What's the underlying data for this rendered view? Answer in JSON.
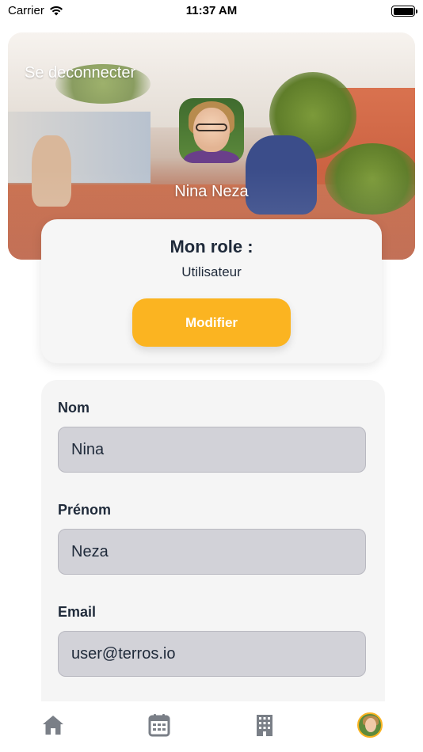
{
  "status_bar": {
    "carrier": "Carrier",
    "time": "11:37 AM"
  },
  "header": {
    "logout_label": "Se deconnecter",
    "user_name": "Nina Neza"
  },
  "role_card": {
    "title": "Mon role :",
    "role": "Utilisateur",
    "button_label": "Modifier"
  },
  "profile_form": {
    "fields": [
      {
        "label": "Nom",
        "value": "Nina"
      },
      {
        "label": "Prénom",
        "value": "Neza"
      },
      {
        "label": "Email",
        "value": "user@terros.io"
      }
    ]
  },
  "tab_bar": {
    "items": [
      {
        "icon": "home-icon"
      },
      {
        "icon": "calendar-icon"
      },
      {
        "icon": "building-icon"
      },
      {
        "icon": "profile-avatar"
      }
    ]
  },
  "colors": {
    "accent": "#fbb421",
    "text": "#1f2a3a",
    "input_bg": "#d2d2d8",
    "icon_gray": "#7a7f87"
  }
}
